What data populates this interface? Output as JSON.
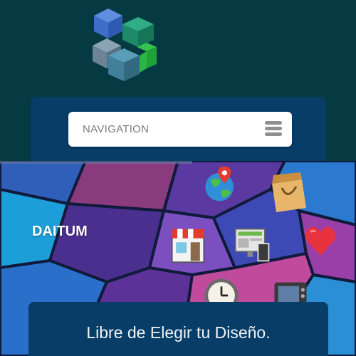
{
  "header": {
    "logo_icon": "cubes-logo-icon",
    "colors": {
      "background": "#053a43",
      "panel": "#073d66",
      "cube_blue": "#3a6bc9",
      "cube_green": "#1f9a6a",
      "cube_grey": "#5d7f96"
    }
  },
  "navigation": {
    "label": "NAVIGATION",
    "menu_icon": "hamburger-menu-icon"
  },
  "hero": {
    "brand": "DAITUM",
    "icons": [
      "globe-pin-icon",
      "shopping-bag-icon",
      "storefront-icon",
      "web-devices-icon",
      "heart-icon",
      "clock-icon",
      "tv-icon"
    ]
  },
  "footer": {
    "tagline": "Libre de Elegir tu Diseño."
  }
}
